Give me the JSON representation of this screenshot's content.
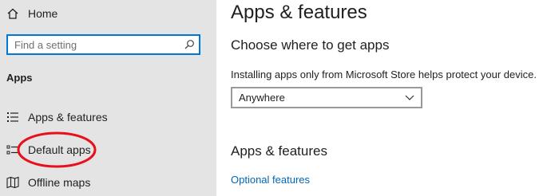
{
  "colors": {
    "sidebar_bg": "#e4e4e4",
    "accent": "#0078d7",
    "link": "#0067b8",
    "highlight_ring": "#e8101c"
  },
  "sidebar": {
    "home": {
      "label": "Home",
      "icon": "home-icon"
    },
    "search": {
      "placeholder": "Find a setting",
      "value": "",
      "icon": "search-icon"
    },
    "section_label": "Apps",
    "items": [
      {
        "label": "Apps & features",
        "icon": "apps-features-icon"
      },
      {
        "label": "Default apps",
        "icon": "default-apps-icon",
        "highlighted": true
      },
      {
        "label": "Offline maps",
        "icon": "offline-maps-icon"
      }
    ]
  },
  "main": {
    "title": "Apps & features",
    "choose_heading": "Choose where to get apps",
    "description": "Installing apps only from Microsoft Store helps protect your device.",
    "source_dropdown": {
      "value": "Anywhere",
      "icon": "chevron-down-icon"
    },
    "apps_heading": "Apps & features",
    "optional_features_link": "Optional features"
  }
}
